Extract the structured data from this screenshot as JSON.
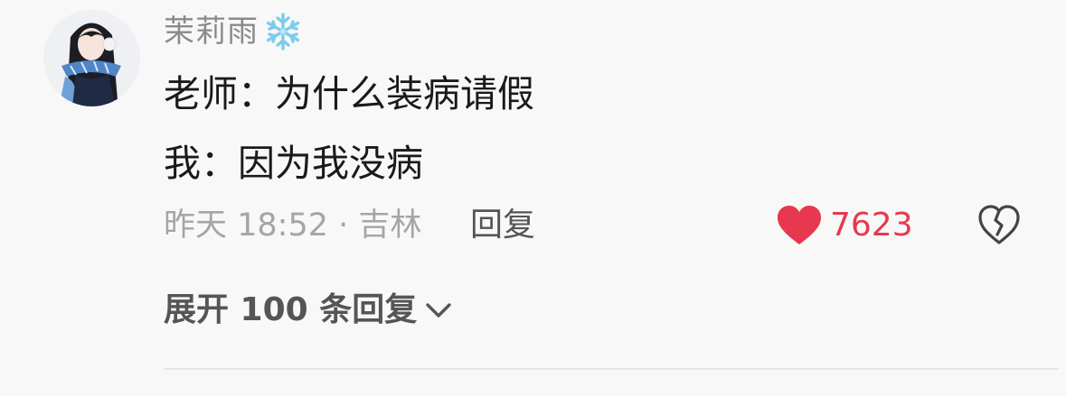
{
  "comment": {
    "username": "茉莉雨",
    "badge_icon": "snowflake-icon",
    "content_lines": [
      "老师：为什么装病请假",
      "我：因为我没病"
    ],
    "meta": "昨天 18:52 · 吉林",
    "reply_label": "回复",
    "like_icon": "heart-icon",
    "like_count": "7623",
    "dislike_icon": "broken-heart-icon",
    "expand_label": "展开 100 条回复",
    "expand_icon": "chevron-down-icon",
    "colors": {
      "like": "#e8384f",
      "badge": "#8fd3f0",
      "text": "#1a1a1a",
      "muted": "#a5a5a5"
    }
  }
}
